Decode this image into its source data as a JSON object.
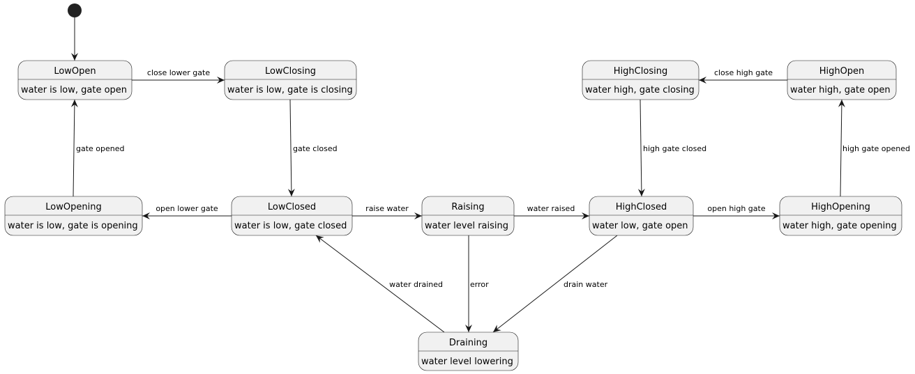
{
  "diagram": {
    "type": "state-diagram",
    "colors": {
      "state_fill": "#F1F1F1",
      "border": "#181818",
      "start": "#222222"
    },
    "states": [
      {
        "id": "LowOpen",
        "name": "LowOpen",
        "description": "water is low, gate open"
      },
      {
        "id": "LowClosing",
        "name": "LowClosing",
        "description": "water is low, gate is closing"
      },
      {
        "id": "HighClosing",
        "name": "HighClosing",
        "description": "water high, gate closing"
      },
      {
        "id": "HighOpen",
        "name": "HighOpen",
        "description": "water high, gate open"
      },
      {
        "id": "LowOpening",
        "name": "LowOpening",
        "description": "water is low, gate is opening"
      },
      {
        "id": "LowClosed",
        "name": "LowClosed",
        "description": "water is low, gate closed"
      },
      {
        "id": "Raising",
        "name": "Raising",
        "description": "water level raising"
      },
      {
        "id": "HighClosed",
        "name": "HighClosed",
        "description": "water low, gate open"
      },
      {
        "id": "HighOpening",
        "name": "HighOpening",
        "description": "water high, gate opening"
      },
      {
        "id": "Draining",
        "name": "Draining",
        "description": "water level lowering"
      }
    ],
    "transitions": [
      {
        "from": "start",
        "to": "LowOpen",
        "label": ""
      },
      {
        "from": "LowOpen",
        "to": "LowClosing",
        "label": "close lower gate"
      },
      {
        "from": "LowClosing",
        "to": "LowClosed",
        "label": "gate closed"
      },
      {
        "from": "LowClosed",
        "to": "LowOpening",
        "label": "open lower gate"
      },
      {
        "from": "LowOpening",
        "to": "LowOpen",
        "label": "gate opened"
      },
      {
        "from": "LowClosed",
        "to": "Raising",
        "label": "raise water"
      },
      {
        "from": "Raising",
        "to": "HighClosed",
        "label": "water raised"
      },
      {
        "from": "Raising",
        "to": "Draining",
        "label": "error"
      },
      {
        "from": "HighClosed",
        "to": "Draining",
        "label": "drain water"
      },
      {
        "from": "Draining",
        "to": "LowClosed",
        "label": "water drained"
      },
      {
        "from": "HighClosed",
        "to": "HighOpening",
        "label": "open high gate"
      },
      {
        "from": "HighOpening",
        "to": "HighOpen",
        "label": "high gate opened"
      },
      {
        "from": "HighOpen",
        "to": "HighClosing",
        "label": "close high gate"
      },
      {
        "from": "HighClosing",
        "to": "HighClosed",
        "label": "high gate closed"
      }
    ]
  }
}
